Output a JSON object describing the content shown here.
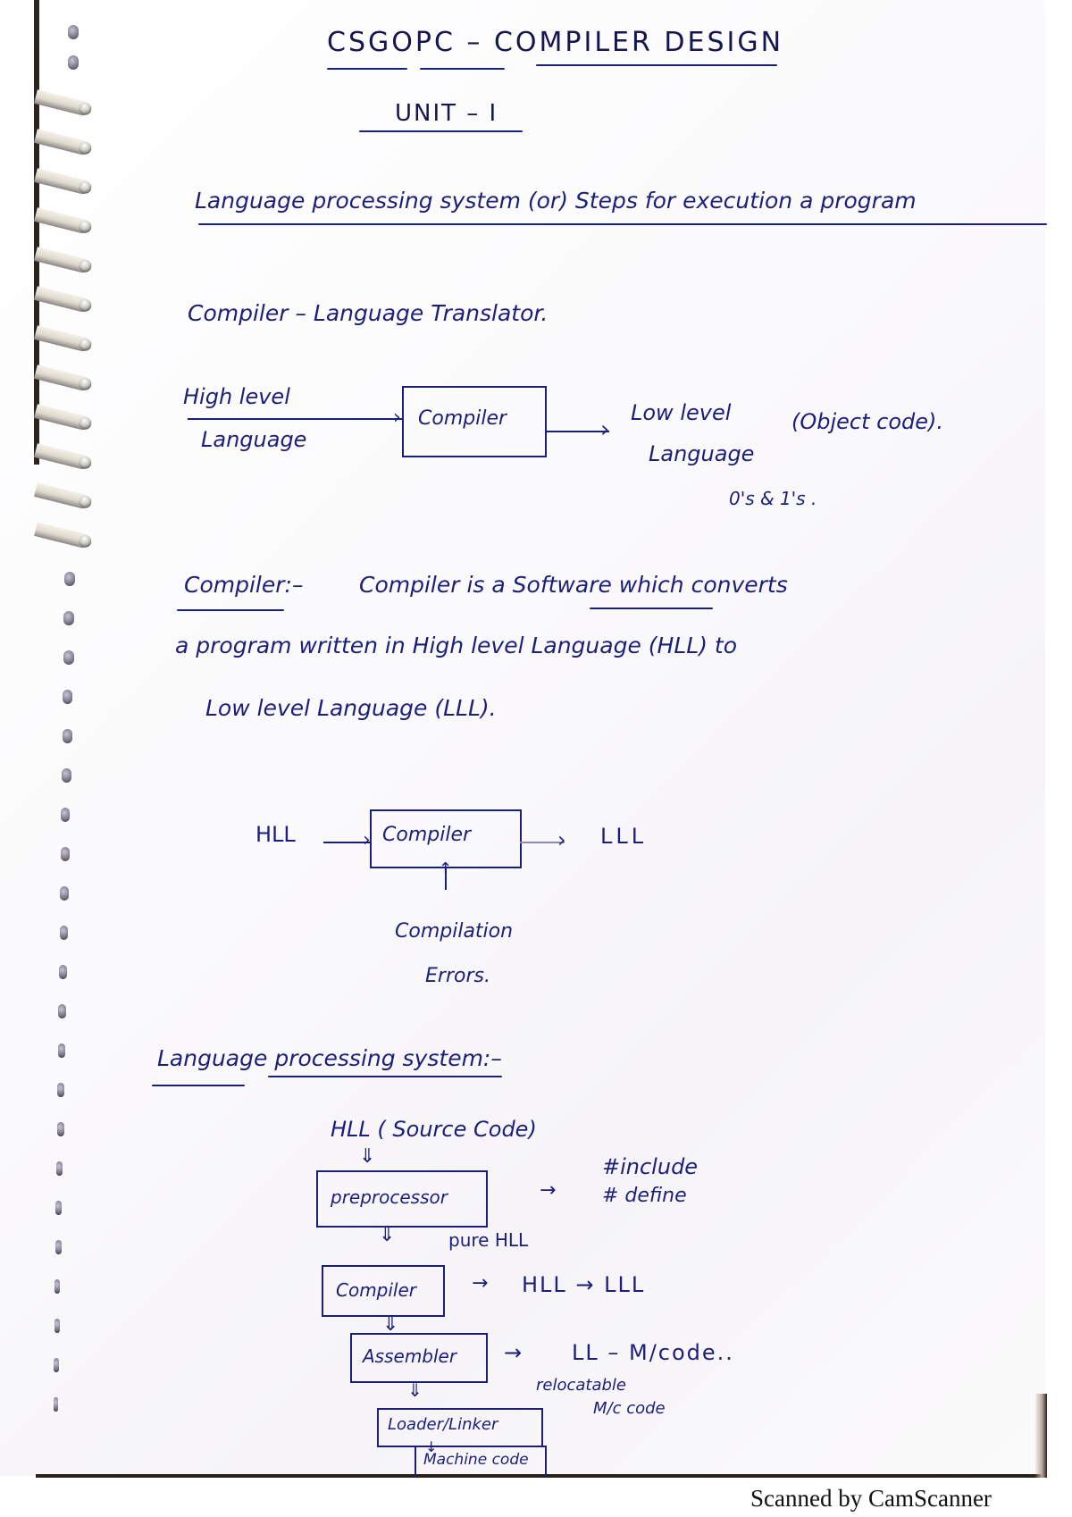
{
  "header": {
    "course_title": "CSGOPC – COMPILER DESIGN",
    "unit": "UNIT – I"
  },
  "section1": {
    "heading": "Language processing system (or) Steps for execution a program",
    "compiler_def_short": "Compiler – Language Translator."
  },
  "diagram1": {
    "input_label_line1": "High level",
    "input_label_line2": "Language",
    "box_label": "Compiler",
    "output_label_line1": "Low level",
    "output_label_line2": "Language",
    "output_note": "(Object code).",
    "output_note2": "0's & 1's ."
  },
  "definition": {
    "term": "Compiler:–",
    "line1_rest": "Compiler is a Software which converts",
    "underlined_word": "Software",
    "line2": "a program written in High level Language (HLL) to",
    "line3": "Low level Language (LLL)."
  },
  "diagram2": {
    "input": "HLL",
    "box_label": "Compiler",
    "output": "LLL",
    "bottom_label_line1": "Compilation",
    "bottom_label_line2": "Errors."
  },
  "section2": {
    "heading": "Language processing system:–"
  },
  "pipeline": {
    "source": "HLL ( Source Code)",
    "stages": [
      {
        "label": "preprocessor",
        "note": "#include",
        "note2": "# define",
        "arrow": "→"
      },
      {
        "label": "Compiler",
        "note": "HLL → LLL",
        "arrow": "→"
      },
      {
        "label": "Assembler",
        "note": "LL – M/code..",
        "arrow": "→"
      },
      {
        "label": "Loader/Linker",
        "note": "relocatable",
        "note2": "M/c code"
      },
      {
        "label": "Machine code"
      }
    ],
    "between_pre_comp": "pure HLL"
  },
  "footer": {
    "watermark": "Scanned by CamScanner"
  }
}
